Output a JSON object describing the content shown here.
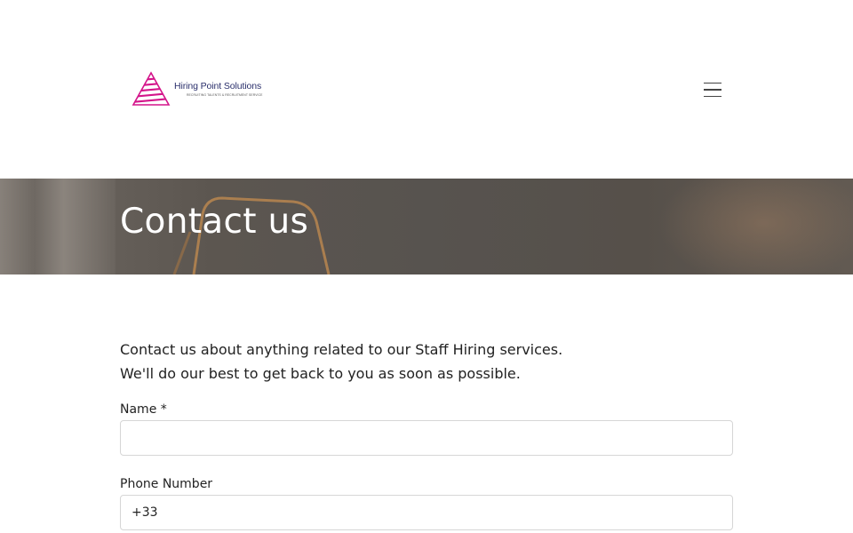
{
  "header": {
    "logo": {
      "name": "Hiring Point Solutions",
      "tagline": "RECRUITING TALENTS & RECRUITMENT SERVICE",
      "accent_color": "#d4148a"
    },
    "menu_icon": "hamburger-menu-icon"
  },
  "hero": {
    "title": "Contact us"
  },
  "intro": {
    "line1": "Contact us about anything related to our Staff Hiring services.",
    "line2": "We'll do our best to get back to you as soon as possible."
  },
  "form": {
    "name_label": "Name *",
    "name_value": "",
    "phone_label": "Phone Number",
    "phone_value": "+33"
  }
}
